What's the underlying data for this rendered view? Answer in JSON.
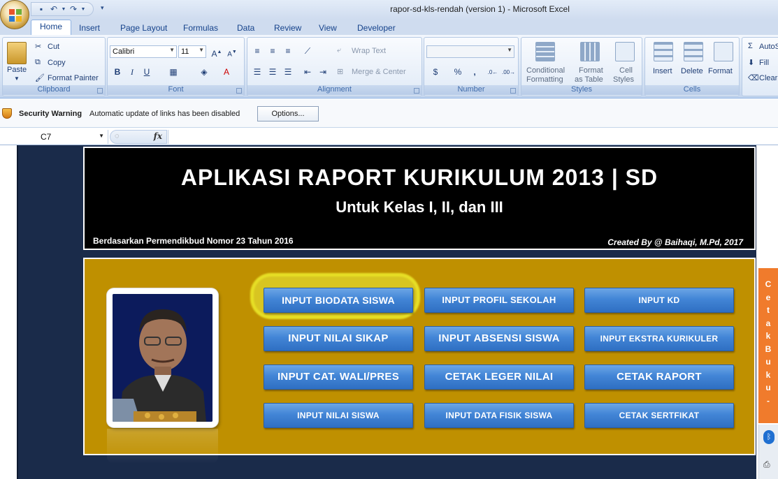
{
  "window": {
    "title": "rapor-sd-kls-rendah (version 1)  -  Microsoft Excel"
  },
  "qat": {
    "save_icon": "save-icon",
    "undo_icon": "undo-icon",
    "redo_icon": "redo-icon"
  },
  "tabs": [
    {
      "label": "Home"
    },
    {
      "label": "Insert"
    },
    {
      "label": "Page Layout"
    },
    {
      "label": "Formulas"
    },
    {
      "label": "Data"
    },
    {
      "label": "Review"
    },
    {
      "label": "View"
    },
    {
      "label": "Developer"
    }
  ],
  "ribbon": {
    "clipboard": {
      "label": "Clipboard",
      "paste": "Paste",
      "cut": "Cut",
      "copy": "Copy",
      "format_painter": "Format Painter"
    },
    "font": {
      "label": "Font",
      "font_name": "Calibri",
      "font_size": "11"
    },
    "alignment": {
      "label": "Alignment",
      "wrap_text": "Wrap Text",
      "merge_center": "Merge & Center"
    },
    "number": {
      "label": "Number",
      "format": "",
      "currency": "$",
      "percent": "%",
      "comma": ","
    },
    "styles": {
      "label": "Styles",
      "conditional": "Conditional",
      "conditional2": "Formatting",
      "format_table": "Format",
      "format_table2": "as Table",
      "cell_styles": "Cell",
      "cell_styles2": "Styles"
    },
    "cells": {
      "label": "Cells",
      "insert": "Insert",
      "delete": "Delete",
      "format": "Format"
    },
    "editing": {
      "autosum": "AutoS",
      "fill": "Fill",
      "clear": "Clear"
    }
  },
  "security": {
    "title": "Security Warning",
    "message": "Automatic update of links has been disabled",
    "options_button": "Options..."
  },
  "formula_bar": {
    "name_box": "C7",
    "fx": "fx",
    "content": ""
  },
  "sheet": {
    "banner_title": "APLIKASI RAPORT KURIKULUM 2013 | SD",
    "banner_subtitle": "Untuk Kelas I, II, dan III",
    "banner_left": "Berdasarkan Permendikbud Nomor 23  Tahun 2016",
    "banner_right": "Created By @ Baihaqi, M.Pd, 2017",
    "buttons": [
      {
        "label": "INPUT BIODATA SISWA"
      },
      {
        "label": "INPUT PROFIL  SEKOLAH"
      },
      {
        "label": "INPUT KD"
      },
      {
        "label": "INPUT NILAI SIKAP"
      },
      {
        "label": "INPUT ABSENSI SISWA"
      },
      {
        "label": "INPUT EKSTRA KURIKULER"
      },
      {
        "label": "INPUT CAT. WALI/PRES"
      },
      {
        "label": "CETAK LEGER NILAI"
      },
      {
        "label": "CETAK RAPORT"
      },
      {
        "label": "INPUT NILAI SISWA"
      },
      {
        "label": "INPUT DATA FISIK SISWA"
      },
      {
        "label": "CETAK SERTFIKAT"
      }
    ]
  },
  "side_tab": {
    "letters": [
      "C",
      "e",
      "t",
      "a",
      "k",
      "B",
      "u",
      "k",
      "u",
      "-"
    ]
  },
  "colors": {
    "banner_bg": "#000000",
    "panel_gold": "#bf9000",
    "button_blue": "#4285d6",
    "sheet_navy": "#1a2b4a",
    "side_orange": "#f07b2c"
  }
}
